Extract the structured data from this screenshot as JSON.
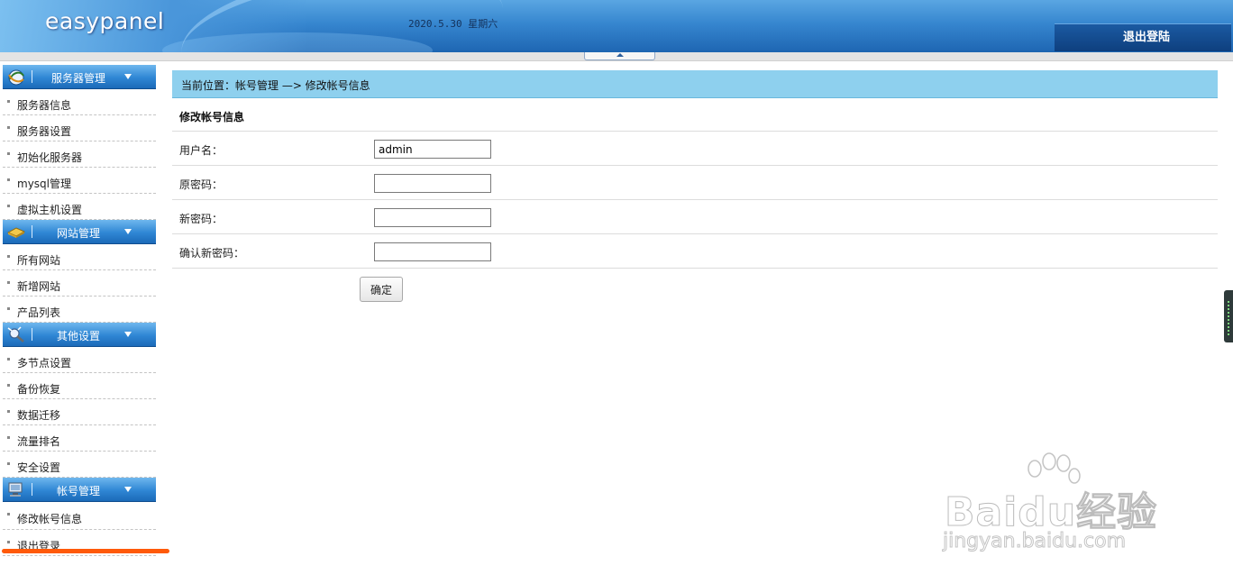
{
  "header": {
    "logo": "easypanel",
    "date": "2020.5.30 星期六",
    "logout_label": "退出登陆"
  },
  "sidebar": {
    "sections": [
      {
        "title": "服务器管理",
        "icon": "server-icon",
        "items": [
          "服务器信息",
          "服务器设置",
          "初始化服务器",
          "mysql管理",
          "虚拟主机设置"
        ]
      },
      {
        "title": "网站管理",
        "icon": "website-icon",
        "items": [
          "所有网站",
          "新增网站",
          "产品列表"
        ]
      },
      {
        "title": "其他设置",
        "icon": "settings-icon",
        "items": [
          "多节点设置",
          "备份恢复",
          "数据迁移",
          "流量排名",
          "安全设置"
        ]
      },
      {
        "title": "帐号管理",
        "icon": "account-icon",
        "items": [
          "修改帐号信息",
          "退出登录"
        ]
      }
    ]
  },
  "main": {
    "breadcrumb": "当前位置：帐号管理 —> 修改帐号信息",
    "form_title": "修改帐号信息",
    "fields": [
      {
        "label": "用户名：",
        "value": "admin"
      },
      {
        "label": "原密码：",
        "value": ""
      },
      {
        "label": "新密码：",
        "value": ""
      },
      {
        "label": "确认新密码：",
        "value": ""
      }
    ],
    "submit_label": "确定"
  },
  "watermark": {
    "brand": "Baidu经验",
    "url": "jingyan.baidu.com"
  },
  "colors": {
    "header_blue": "#3686cf",
    "breadcrumb_bg": "#8ed0ee",
    "highlight_underline": "#ff5a0a"
  }
}
